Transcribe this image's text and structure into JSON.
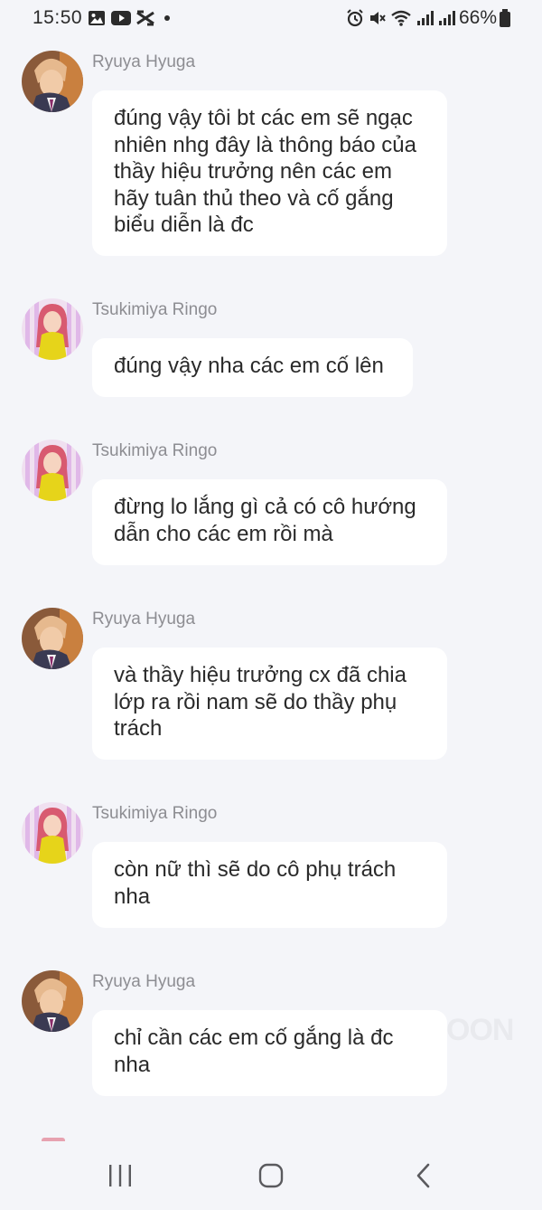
{
  "status_bar": {
    "time": "15:50",
    "battery": "66%"
  },
  "messages": [
    {
      "sender": "Ryuya Hyuga",
      "avatar": "ryuya-avatar",
      "text": "đúng vậy tôi bt các em sẽ ngạc nhiên nhg đây là thông báo của thầy hiệu trưởng nên các em hãy tuân thủ theo và cố gắng biểu diễn là đc"
    },
    {
      "sender": "Tsukimiya Ringo",
      "avatar": "ringo-avatar",
      "text": "đúng vậy nha các em cố lên"
    },
    {
      "sender": "Tsukimiya Ringo",
      "avatar": "ringo-avatar",
      "text": "đừng lo lắng gì cả có cô hướng dẫn cho các em rồi mà"
    },
    {
      "sender": "Ryuya Hyuga",
      "avatar": "ryuya-avatar",
      "text": "và thầy hiệu trưởng cx đã chia lớp ra rồi nam sẽ do thầy phụ trách"
    },
    {
      "sender": "Tsukimiya Ringo",
      "avatar": "ringo-avatar",
      "text": "còn nữ thì sẽ do cô phụ trách nha"
    },
    {
      "sender": "Ryuya Hyuga",
      "avatar": "ryuya-avatar",
      "text": "chỉ cần các em cố gắng là đc nha"
    }
  ],
  "watermark": "OON",
  "colors": {
    "background": "#f4f5f9",
    "bubble": "#ffffff",
    "sender_name": "#8d8d92",
    "message_text": "#2a2a2a"
  },
  "icons": {
    "nav": [
      "recent-apps-icon",
      "home-icon",
      "back-icon"
    ],
    "status_left": [
      "gallery-icon",
      "youtube-icon",
      "capcut-icon",
      "dot-icon"
    ],
    "status_right": [
      "alarm-icon",
      "mute-icon",
      "wifi-icon",
      "signal-icon",
      "signal-icon",
      "battery-icon"
    ]
  }
}
